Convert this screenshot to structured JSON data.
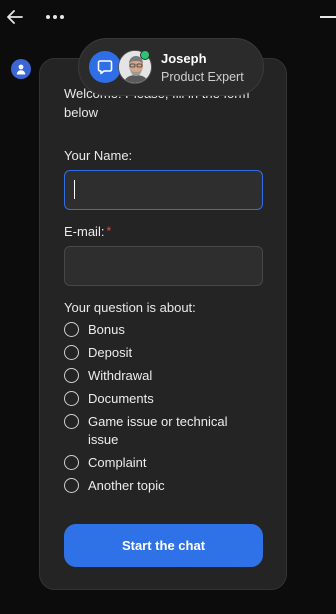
{
  "header": {
    "back_icon": "arrow-left-icon",
    "more_icon": "more-horizontal-icon",
    "minimize_icon": "minimize-icon"
  },
  "agent": {
    "name": "Joseph",
    "role": "Product Expert",
    "status_color": "#2ec276"
  },
  "form": {
    "intro": "Welcome! Please, fill in the form below",
    "name_label": "Your Name:",
    "name_value": "",
    "email_label": "E-mail:",
    "email_required_mark": "*",
    "email_value": "",
    "topic_label": "Your question is about:",
    "topics": [
      "Bonus",
      "Deposit",
      "Withdrawal",
      "Documents",
      "Game issue or technical issue",
      "Complaint",
      "Another topic"
    ],
    "submit_label": "Start the chat"
  },
  "colors": {
    "accent": "#2f72e8",
    "background": "#0c0c0c",
    "card": "#242424",
    "required": "#e0503f"
  }
}
